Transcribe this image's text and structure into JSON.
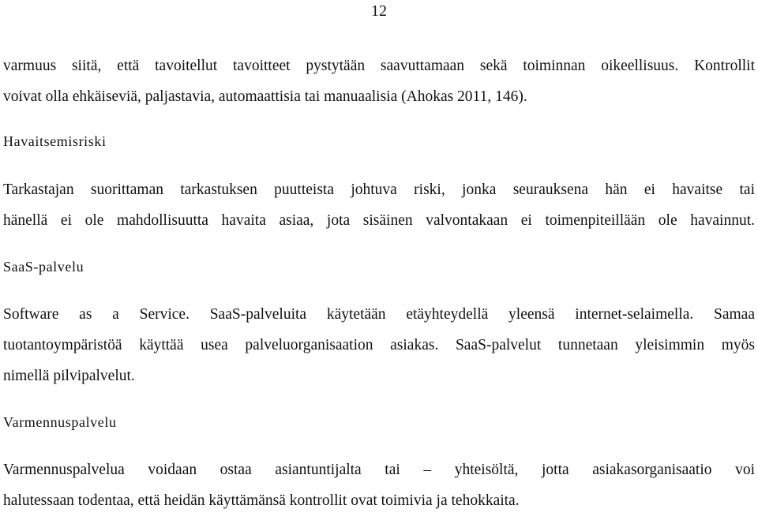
{
  "page": {
    "number": "12"
  },
  "sections": {
    "intro": {
      "lines": [
        "varmuus siitä, että tavoitellut tavoitteet pystytään saavuttamaan sekä toiminnan oikeellisuus. Kontrollit",
        "voivat olla ehkäiseviä, paljastavia, automaattisia tai manuaalisia (Ahokas 2011, 146)."
      ]
    },
    "havaitsemisriski": {
      "heading": "Havaitsemisriski",
      "lines": [
        "Tarkastajan suorittaman tarkastuksen puutteista johtuva riski, jonka seurauksena hän ei havaitse tai",
        "hänellä ei ole mahdollisuutta havaita asiaa, jota sisäinen valvontakaan ei toimenpiteillään ole havainnut."
      ]
    },
    "saas": {
      "heading": "SaaS-palvelu",
      "lines": [
        "Software as a Service. SaaS-palveluita käytetään etäyhteydellä yleensä internet-selaimella. Samaa",
        "tuotantoympäristöä käyttää usea palveluorganisaation asiakas. SaaS-palvelut tunnetaan yleisimmin myös",
        "nimellä pilvipalvelut."
      ]
    },
    "varmennuspalvelu": {
      "heading": "Varmennuspalvelu",
      "lines": [
        "Varmennuspalvelua voidaan ostaa asiantuntijalta tai – yhteisöltä, jotta asiakasorganisaatio voi",
        "halutessaan todentaa, että heidän käyttämänsä kontrollit ovat toimivia ja tehokkaita."
      ]
    }
  }
}
